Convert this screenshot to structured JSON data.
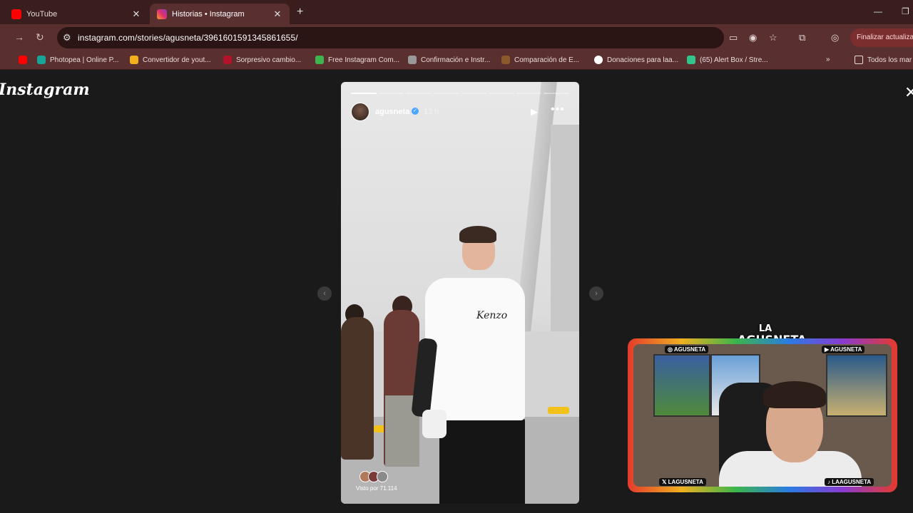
{
  "browser": {
    "tabs": [
      {
        "title": "YouTube",
        "favicon": "youtube-icon",
        "favicon_color": "#ff0000"
      },
      {
        "title": "Historias • Instagram",
        "favicon": "instagram-icon",
        "favicon_color": "#e1306c",
        "active": true
      }
    ],
    "url": "instagram.com/stories/agusneta/3961601591345861655/",
    "update_button": "Finalizar actualiza",
    "bookmarks": [
      {
        "label": "",
        "icon": "youtube-icon",
        "color": "#ff0000"
      },
      {
        "label": "Photopea | Online P...",
        "icon": "photopea-icon",
        "color": "#18a497"
      },
      {
        "label": "Convertidor de yout...",
        "icon": "converter-icon",
        "color": "#f2b01e"
      },
      {
        "label": "Sorpresivo cambio...",
        "icon": "news-icon",
        "color": "#b3122a"
      },
      {
        "label": "Free Instagram Com...",
        "icon": "w-icon",
        "color": "#3fb34f"
      },
      {
        "label": "Confirmación e Instr...",
        "icon": "link-icon",
        "color": "#999999"
      },
      {
        "label": "Comparación de E...",
        "icon": "compare-icon",
        "color": "#8a5a2a"
      },
      {
        "label": "Donaciones para laa...",
        "icon": "donation-icon",
        "color": "#ffffff"
      },
      {
        "label": "(65) Alert Box / Stre...",
        "icon": "alert-box-icon",
        "color": "#31c48d"
      }
    ],
    "all_bookmarks": "Todos los mar"
  },
  "page": {
    "logo": "Instagram",
    "story": {
      "username": "agusneta",
      "time": "13 h",
      "segments_total": 8,
      "segments_done": 1,
      "viewed_by": "Visto por 71.114",
      "shirt_text": "Kenzo"
    }
  },
  "overlay": {
    "logo_top": "LA",
    "logo_bottom": "AGUSNETA",
    "labels": {
      "instagram": "AGUSNETA",
      "youtube": "AGUSNETA",
      "x": "LAGUSNETA",
      "tiktok": "LAAGUSNETA"
    }
  }
}
